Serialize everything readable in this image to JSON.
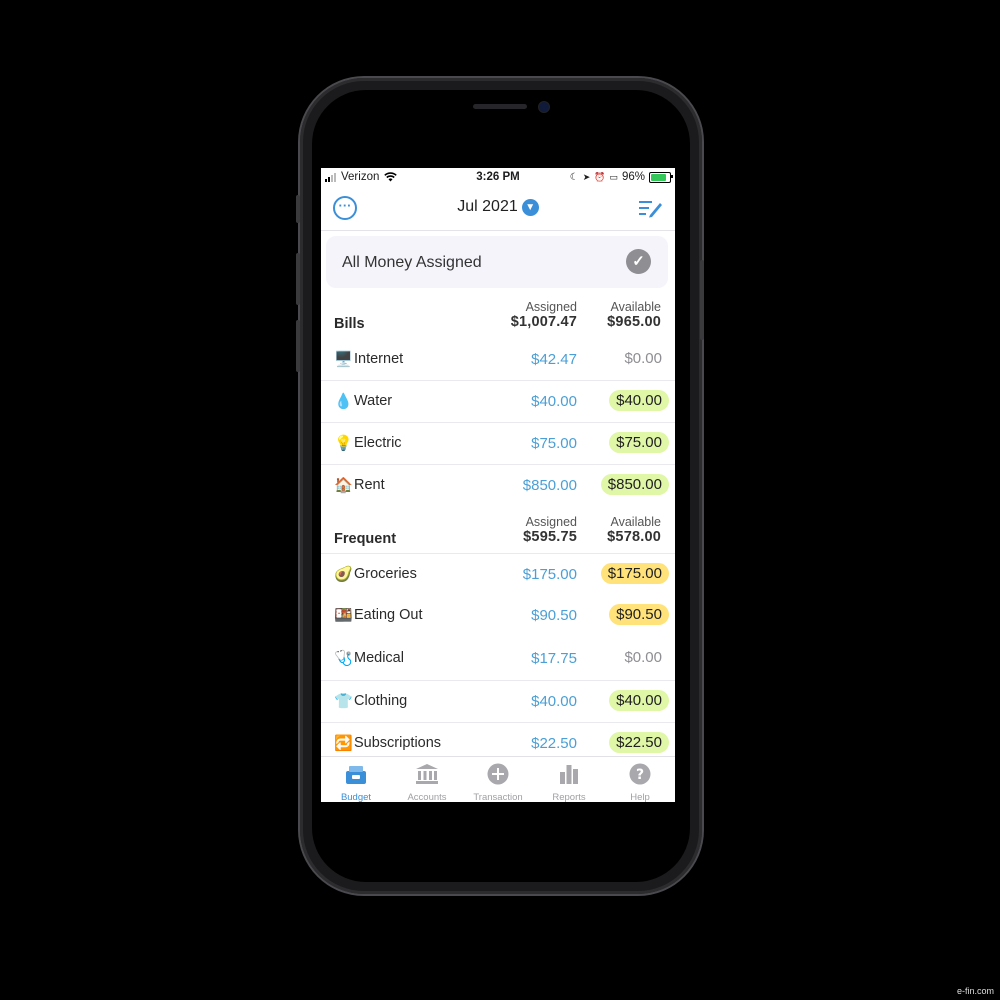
{
  "status_bar": {
    "carrier": "Verizon",
    "time": "3:26 PM",
    "battery": "96%"
  },
  "nav": {
    "month": "Jul 2021",
    "more_icon": "ellipsis-circle-icon",
    "edit_icon": "list-edit-icon"
  },
  "banner": {
    "text": "All Money Assigned"
  },
  "groups": [
    {
      "title": "Bills",
      "assigned_label": "Assigned",
      "assigned_total": "$1,007.47",
      "available_label": "Available",
      "available_total": "$965.00",
      "items": [
        {
          "emoji": "🖥️",
          "name": "Internet",
          "assigned": "$42.47",
          "available": "$0.00",
          "status": "zero"
        },
        {
          "emoji": "💧",
          "name": "Water",
          "assigned": "$40.00",
          "available": "$40.00",
          "status": "green"
        },
        {
          "emoji": "💡",
          "name": "Electric",
          "assigned": "$75.00",
          "available": "$75.00",
          "status": "green"
        },
        {
          "emoji": "🏠",
          "name": "Rent",
          "assigned": "$850.00",
          "available": "$850.00",
          "status": "green"
        }
      ]
    },
    {
      "title": "Frequent",
      "assigned_label": "Assigned",
      "assigned_total": "$595.75",
      "available_label": "Available",
      "available_total": "$578.00",
      "items": [
        {
          "emoji": "🥑",
          "name": "Groceries",
          "assigned": "$175.00",
          "available": "$175.00",
          "status": "yellow"
        },
        {
          "emoji": "🍱",
          "name": "Eating Out",
          "assigned": "$90.50",
          "available": "$90.50",
          "status": "yellow"
        },
        {
          "emoji": "🩺",
          "name": "Medical",
          "assigned": "$17.75",
          "available": "$0.00",
          "status": "zero"
        },
        {
          "emoji": "👕",
          "name": "Clothing",
          "assigned": "$40.00",
          "available": "$40.00",
          "status": "green"
        },
        {
          "emoji": "🔁",
          "name": "Subscriptions",
          "assigned": "$22.50",
          "available": "$22.50",
          "status": "green"
        }
      ]
    }
  ],
  "tabs": [
    {
      "label": "Budget",
      "icon": "budget-icon",
      "active": true
    },
    {
      "label": "Accounts",
      "icon": "bank-icon",
      "active": false
    },
    {
      "label": "Transaction",
      "icon": "plus-circle-icon",
      "active": false
    },
    {
      "label": "Reports",
      "icon": "bar-chart-icon",
      "active": false
    },
    {
      "label": "Help",
      "icon": "help-icon",
      "active": false
    }
  ],
  "colors": {
    "accent": "#3b8fd9",
    "assigned_text": "#4b9fd6",
    "available_green": "#dff7a6",
    "available_yellow": "#ffe27a"
  },
  "watermark": "e-fin.com"
}
